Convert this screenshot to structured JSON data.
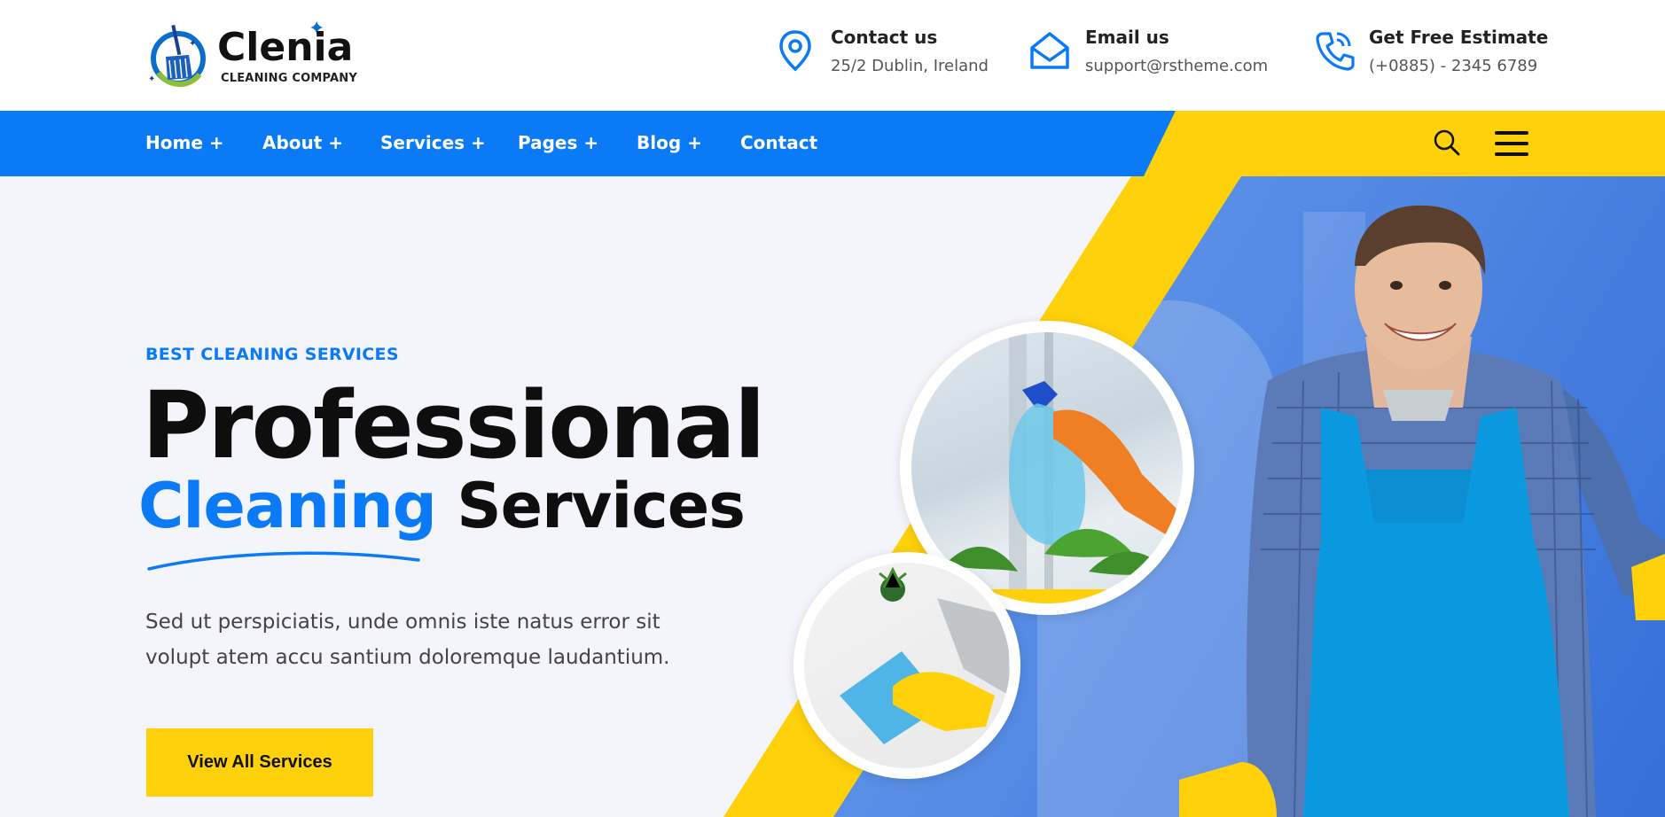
{
  "brand": {
    "name": "Clenia",
    "tagline": "CLEANING COMPANY"
  },
  "header": {
    "contacts": [
      {
        "icon": "location-pin-icon",
        "title": "Contact us",
        "value": "25/2 Dublin, Ireland"
      },
      {
        "icon": "envelope-icon",
        "title": "Email us",
        "value": "support@rstheme.com"
      },
      {
        "icon": "phone-icon",
        "title": "Get Free Estimate",
        "value": "(+0885) - 2345 6789"
      }
    ]
  },
  "nav": {
    "items": [
      {
        "label": "Home +"
      },
      {
        "label": "About +"
      },
      {
        "label": "Services +"
      },
      {
        "label": "Pages +"
      },
      {
        "label": "Blog +"
      },
      {
        "label": "Contact"
      }
    ],
    "search_icon": "search-icon",
    "menu_icon": "hamburger-menu-icon"
  },
  "hero": {
    "eyebrow": "BEST CLEANING SERVICES",
    "title_line1": "Professional",
    "title_line2_accent": "Cleaning",
    "title_line2_rest": "Services",
    "description": "Sed ut perspiciatis, unde omnis iste natus error sit volupt atem accu santium doloremque laudantium.",
    "cta_label": "View All Services"
  },
  "colors": {
    "primary_blue": "#0a7af7",
    "accent_yellow": "#ffd10a",
    "text_dark": "#0e0e0e",
    "hero_bg": "#f4f4fb"
  }
}
